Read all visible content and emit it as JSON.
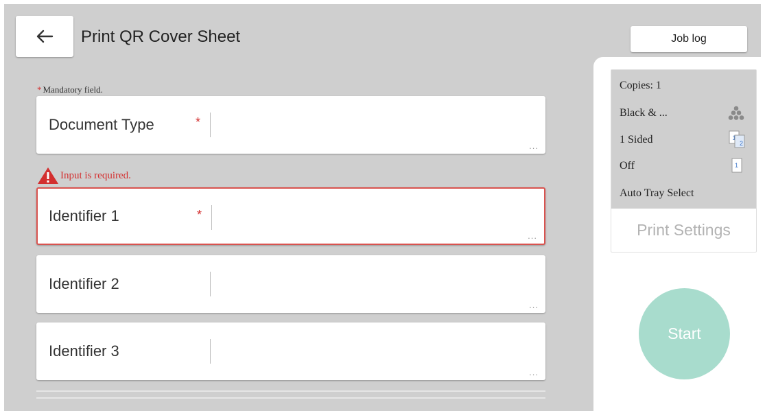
{
  "header": {
    "back_icon": "arrow-left-icon",
    "title": "Print QR Cover Sheet",
    "job_log_label": "Job log"
  },
  "form": {
    "mandatory_marker": "*",
    "mandatory_note": "Mandatory field.",
    "error_message": "Input is required.",
    "error_icon": "warning-icon",
    "more_indicator": "...",
    "fields": [
      {
        "label": "Document Type",
        "required": true,
        "value": "",
        "error": false
      },
      {
        "label": "Identifier 1",
        "required": true,
        "value": "",
        "error": true
      },
      {
        "label": "Identifier 2",
        "required": false,
        "value": "",
        "error": false
      },
      {
        "label": "Identifier 3",
        "required": false,
        "value": "",
        "error": false
      }
    ]
  },
  "print_settings": {
    "copies": "Copies: 1",
    "color": "Black & ...",
    "color_icon": "toner-dots-icon",
    "sides": "1 Sided",
    "sides_icon": "one-sided-icon",
    "staple": "Off",
    "staple_icon": "page-icon",
    "tray": "Auto Tray Select",
    "link_label": "Print Settings"
  },
  "start_label": "Start",
  "colors": {
    "background": "#cfcfcf",
    "error": "#d32f2f",
    "start_button": "#a8dccd",
    "muted_text": "#b3b3b3"
  }
}
